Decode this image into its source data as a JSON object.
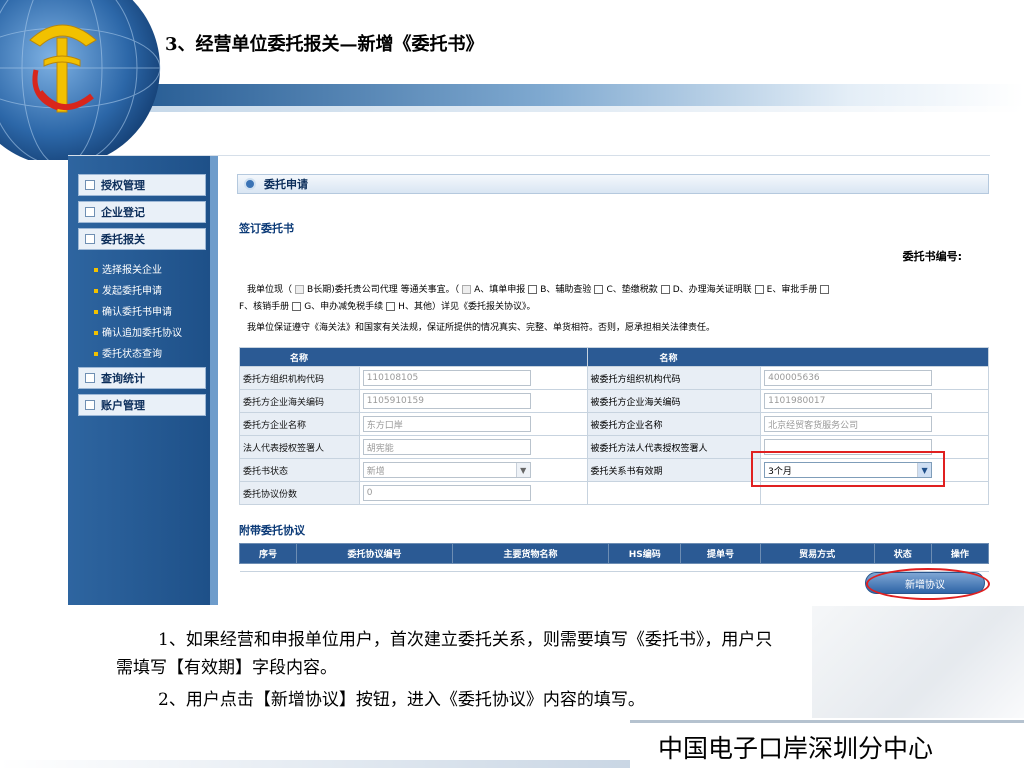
{
  "slide": {
    "title": "3、经营单位委托报关—新增《委托书》",
    "notes": [
      "1、如果经营和申报单位用户，首次建立委托关系，则需要填写《委托书》，用户只",
      "需填写【有效期】字段内容。",
      "2、用户点击【新增协议】按钮，进入《委托协议》内容的填写。"
    ],
    "footer_org": "中国电子口岸深圳分中心"
  },
  "sidebar": {
    "nav": [
      {
        "label": "授权管理"
      },
      {
        "label": "企业登记"
      },
      {
        "label": "委托报关"
      },
      {
        "label": "查询统计"
      },
      {
        "label": "账户管理"
      }
    ],
    "sub_items": [
      {
        "label": "选择报关企业"
      },
      {
        "label": "发起委托申请"
      },
      {
        "label": "确认委托书申请"
      },
      {
        "label": "确认追加委托协议"
      },
      {
        "label": "委托状态查询"
      }
    ]
  },
  "main": {
    "header": "委托申请",
    "section_title": "签订委托书",
    "book_number_label": "委托书编号:",
    "para1_a": "我单位现（",
    "para1_b": "B长期)委托贵公司代理  等通关事宜。（",
    "opt_a": "A、填单申报",
    "opt_b": "B、辅助查验",
    "opt_c": "C、垫缴税款",
    "opt_d": "D、办理海关证明联",
    "opt_e": "E、审批手册",
    "opt_f": "F、核销手册",
    "opt_g": "G、申办减免税手续",
    "opt_h": "H、其他",
    "para2_tail": "）详见《委托报关协议》。",
    "para3": "我单位保证遵守《海关法》和国家有关法规，保证所提供的情况真实、完整、单货相符。否则，愿承担相关法律责任。",
    "table": {
      "header_left": "名称",
      "header_right": "名称",
      "rows": [
        {
          "l_label": "委托方组织机构代码",
          "l_value": "110108105",
          "r_label": "被委托方组织机构代码",
          "r_value": "400005636"
        },
        {
          "l_label": "委托方企业海关编码",
          "l_value": "1105910159",
          "r_label": "被委托方企业海关编码",
          "r_value": "1101980017"
        },
        {
          "l_label": "委托方企业名称",
          "l_value": "东方口岸",
          "r_label": "被委托方企业名称",
          "r_value": "北京经贸客货服务公司"
        },
        {
          "l_label": "法人代表授权签署人",
          "l_value": "胡宪能",
          "r_label": "被委托方法人代表授权签署人",
          "r_value": ""
        },
        {
          "l_label": "委托书状态",
          "l_value": "新增",
          "r_label": "委托关系书有效期",
          "r_value": "3个月"
        },
        {
          "l_label": "委托协议份数",
          "l_value": "0",
          "r_label": "",
          "r_value": ""
        }
      ]
    },
    "attach_title": "附带委托协议",
    "attach_columns": [
      "序号",
      "委托协议编号",
      "主要货物名称",
      "HS编码",
      "提单号",
      "贸易方式",
      "状态",
      "操作"
    ],
    "add_button": "新增协议"
  },
  "colors": {
    "nav_blue": "#1d4f87",
    "table_header": "#2b5a94",
    "highlight_red": "#e02020"
  }
}
